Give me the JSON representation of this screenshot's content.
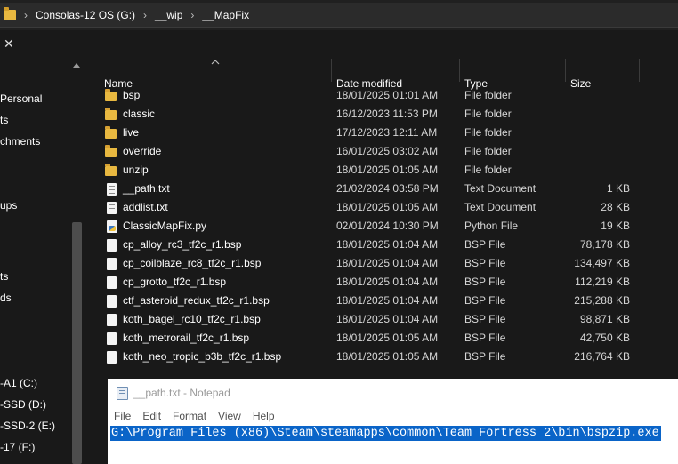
{
  "addressbar": {
    "crumbs": [
      "Consolas-12 OS (G:)",
      "__wip",
      "__MapFix"
    ],
    "separator": "›"
  },
  "tab": {
    "close_glyph": "✕"
  },
  "navpane": {
    "items": [
      {
        "label": "Personal"
      },
      {
        "label": "ts"
      },
      {
        "label": "chments"
      },
      {
        "label": "ups"
      },
      {
        "label": "ts"
      },
      {
        "label": "ds"
      },
      {
        "label": "-A1 (C:)"
      },
      {
        "label": "-SSD (D:)"
      },
      {
        "label": "-SSD-2 (E:)"
      },
      {
        "label": "-17 (F:)"
      }
    ]
  },
  "filelist": {
    "columns": {
      "name": "Name",
      "date": "Date modified",
      "type": "Type",
      "size": "Size"
    },
    "rows": [
      {
        "icon": "folder-icon",
        "name": "bsp",
        "date": "18/01/2025 01:01 AM",
        "type": "File folder",
        "size": ""
      },
      {
        "icon": "folder-icon",
        "name": "classic",
        "date": "16/12/2023 11:53 PM",
        "type": "File folder",
        "size": ""
      },
      {
        "icon": "folder-icon",
        "name": "live",
        "date": "17/12/2023 12:11 AM",
        "type": "File folder",
        "size": ""
      },
      {
        "icon": "folder-icon",
        "name": "override",
        "date": "16/01/2025 03:02 AM",
        "type": "File folder",
        "size": ""
      },
      {
        "icon": "folder-icon",
        "name": "unzip",
        "date": "18/01/2025 01:05 AM",
        "type": "File folder",
        "size": ""
      },
      {
        "icon": "text-file-icon",
        "name": "__path.txt",
        "date": "21/02/2024 03:58 PM",
        "type": "Text Document",
        "size": "1 KB"
      },
      {
        "icon": "text-file-icon",
        "name": "addlist.txt",
        "date": "18/01/2025 01:05 AM",
        "type": "Text Document",
        "size": "28 KB"
      },
      {
        "icon": "python-file-icon",
        "name": "ClassicMapFix.py",
        "date": "02/01/2024 10:30 PM",
        "type": "Python File",
        "size": "19 KB"
      },
      {
        "icon": "file-icon",
        "name": "cp_alloy_rc3_tf2c_r1.bsp",
        "date": "18/01/2025 01:04 AM",
        "type": "BSP File",
        "size": "78,178 KB"
      },
      {
        "icon": "file-icon",
        "name": "cp_coilblaze_rc8_tf2c_r1.bsp",
        "date": "18/01/2025 01:04 AM",
        "type": "BSP File",
        "size": "134,497 KB"
      },
      {
        "icon": "file-icon",
        "name": "cp_grotto_tf2c_r1.bsp",
        "date": "18/01/2025 01:04 AM",
        "type": "BSP File",
        "size": "112,219 KB"
      },
      {
        "icon": "file-icon",
        "name": "ctf_asteroid_redux_tf2c_r1.bsp",
        "date": "18/01/2025 01:04 AM",
        "type": "BSP File",
        "size": "215,288 KB"
      },
      {
        "icon": "file-icon",
        "name": "koth_bagel_rc10_tf2c_r1.bsp",
        "date": "18/01/2025 01:04 AM",
        "type": "BSP File",
        "size": "98,871 KB"
      },
      {
        "icon": "file-icon",
        "name": "koth_metrorail_tf2c_r1.bsp",
        "date": "18/01/2025 01:05 AM",
        "type": "BSP File",
        "size": "42,750 KB"
      },
      {
        "icon": "file-icon",
        "name": "koth_neo_tropic_b3b_tf2c_r1.bsp",
        "date": "18/01/2025 01:05 AM",
        "type": "BSP File",
        "size": "216,764 KB"
      }
    ]
  },
  "notepad": {
    "title": "__path.txt - Notepad",
    "menu": [
      "File",
      "Edit",
      "Format",
      "View",
      "Help"
    ],
    "content": "G:\\Program Files (x86)\\Steam\\steamapps\\common\\Team Fortress 2\\bin\\bspzip.exe"
  },
  "colors": {
    "background": "#191919",
    "folder": "#e8b840",
    "selection": "#0a64c8"
  }
}
